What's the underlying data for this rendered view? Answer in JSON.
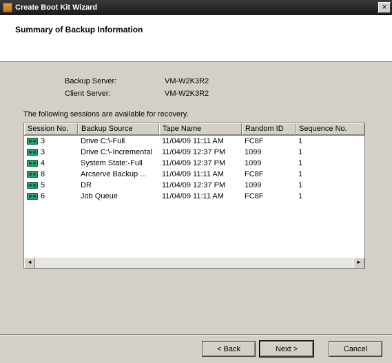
{
  "window": {
    "title": "Create Boot Kit Wizard",
    "close": "×"
  },
  "header": {
    "title": "Summary of Backup Information"
  },
  "info": {
    "backup_server_label": "Backup Server:",
    "backup_server_value": "VM-W2K3R2",
    "client_server_label": "Client Server:",
    "client_server_value": "VM-W2K3R2",
    "avail_text": "The following sessions are available for recovery."
  },
  "columns": {
    "c0": "Session No.",
    "c1": "Backup Source",
    "c2": "Tape Name",
    "c3": "Random ID",
    "c4": "Sequence No."
  },
  "rows": [
    {
      "session": "3",
      "source": "Drive C:\\-Full",
      "tape": "11/04/09 11:11 AM",
      "rand": "FC8F",
      "seq": "1"
    },
    {
      "session": "3",
      "source": "Drive C:\\-Incremental",
      "tape": "11/04/09 12:37 PM",
      "rand": "1099",
      "seq": "1"
    },
    {
      "session": "4",
      "source": "System State:-Full",
      "tape": "11/04/09 12:37 PM",
      "rand": "1099",
      "seq": "1"
    },
    {
      "session": "8",
      "source": "Arcserve Backup ...",
      "tape": "11/04/09 11:11 AM",
      "rand": "FC8F",
      "seq": "1"
    },
    {
      "session": "5",
      "source": "DR",
      "tape": "11/04/09 12:37 PM",
      "rand": "1099",
      "seq": "1"
    },
    {
      "session": "6",
      "source": "Job Queue",
      "tape": "11/04/09 11:11 AM",
      "rand": "FC8F",
      "seq": "1"
    }
  ],
  "buttons": {
    "back": "< Back",
    "next": "Next >",
    "cancel": "Cancel"
  }
}
